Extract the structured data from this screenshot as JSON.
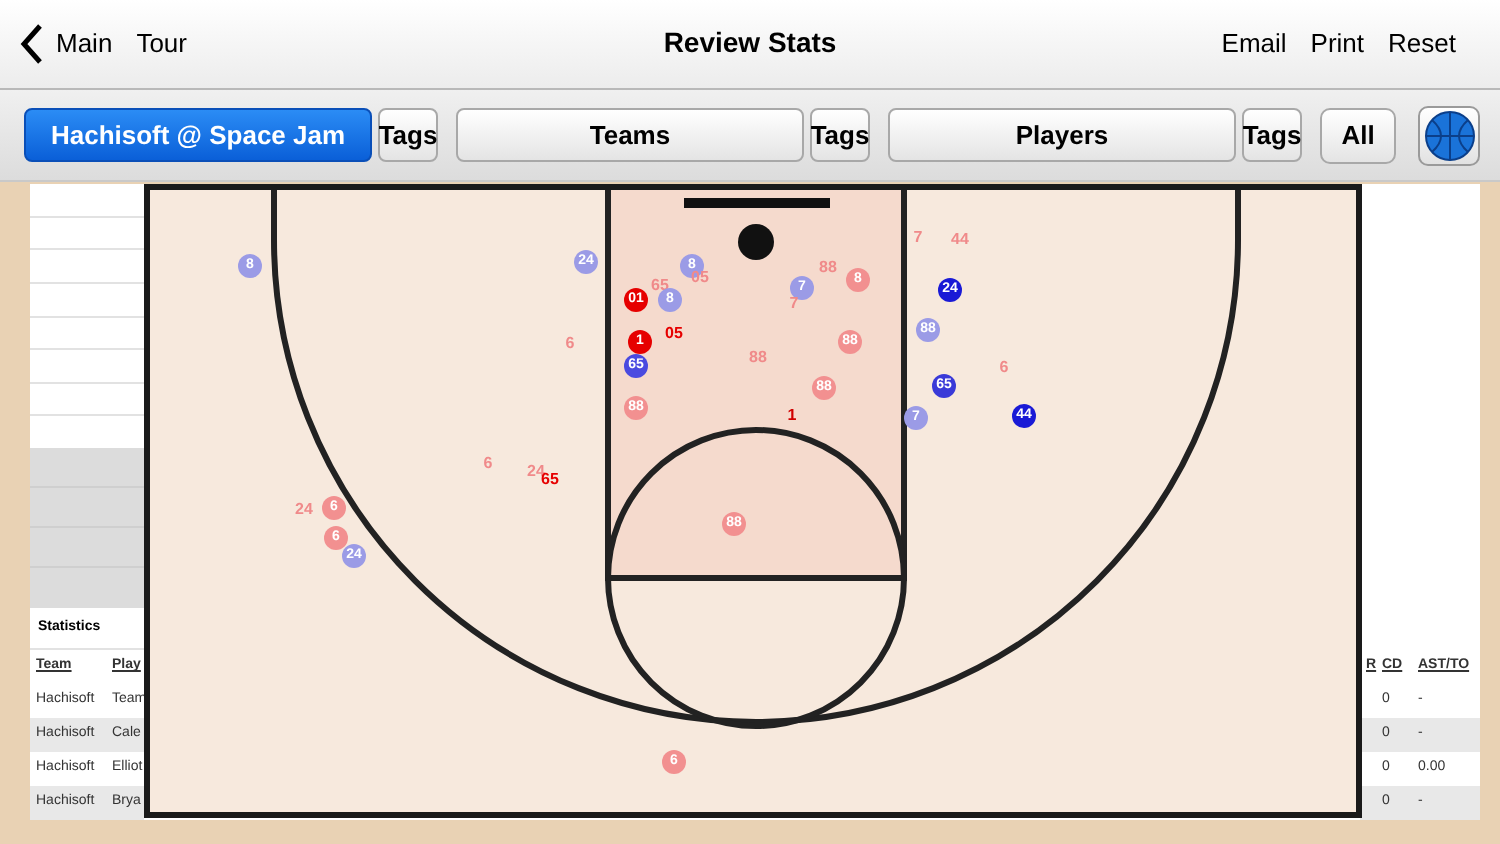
{
  "nav": {
    "back": "Main",
    "left_links": [
      "Tour"
    ],
    "title": "Review Stats",
    "right_links": [
      "Email",
      "Print",
      "Reset"
    ]
  },
  "filters": [
    {
      "label": "Hachisoft @ Space Jam",
      "kind": "selector",
      "selected": true
    },
    {
      "label": "Tags",
      "kind": "tags",
      "selected": false
    },
    {
      "label": "Teams",
      "kind": "selector",
      "selected": false
    },
    {
      "label": "Tags",
      "kind": "tags",
      "selected": false
    },
    {
      "label": "Players",
      "kind": "selector",
      "selected": false
    },
    {
      "label": "Tags",
      "kind": "tags",
      "selected": false
    },
    {
      "label": "All",
      "kind": "all",
      "selected": false
    }
  ],
  "statistics": {
    "title": "Statistics",
    "left_columns": [
      "Team",
      "Play"
    ],
    "left_rows": [
      [
        "Hachisoft",
        "Team"
      ],
      [
        "Hachisoft",
        "Cale"
      ],
      [
        "Hachisoft",
        "Elliot"
      ],
      [
        "Hachisoft",
        "Brya"
      ]
    ],
    "right_columns": [
      "R",
      "CD",
      "AST/TO"
    ],
    "right_rows": [
      [
        "",
        "0",
        "-"
      ],
      [
        "",
        "0",
        "-"
      ],
      [
        "",
        "0",
        "0.00"
      ],
      [
        "",
        "0",
        "-"
      ]
    ]
  },
  "shots": [
    {
      "label": "8",
      "kind": "dot",
      "color": "#9b9be6"
    },
    {
      "label": "24",
      "kind": "dot",
      "color": "#9b9be6"
    },
    {
      "label": "8",
      "kind": "dot",
      "color": "#9b9be6"
    },
    {
      "label": "65",
      "kind": "number",
      "color": "#f08a8a"
    },
    {
      "label": "05",
      "kind": "number",
      "color": "#f08a8a"
    },
    {
      "label": "01",
      "kind": "dot",
      "color": "#e60000"
    },
    {
      "label": "8",
      "kind": "dot",
      "color": "#9b9be6"
    },
    {
      "label": "1",
      "kind": "dot",
      "color": "#e60000"
    },
    {
      "label": "05",
      "kind": "number",
      "color": "#e60000"
    },
    {
      "label": "65",
      "kind": "dot",
      "color": "#4a4ae0"
    },
    {
      "label": "6",
      "kind": "number",
      "color": "#f08a8a"
    },
    {
      "label": "88",
      "kind": "dot",
      "color": "#f29090"
    },
    {
      "label": "7",
      "kind": "dot",
      "color": "#9b9be6"
    },
    {
      "label": "88",
      "kind": "number",
      "color": "#f08a8a"
    },
    {
      "label": "7",
      "kind": "number",
      "color": "#f08a8a"
    },
    {
      "label": "8",
      "kind": "dot",
      "color": "#f29090"
    },
    {
      "label": "88",
      "kind": "dot",
      "color": "#f29090"
    },
    {
      "label": "88",
      "kind": "number",
      "color": "#f08a8a"
    },
    {
      "label": "88",
      "kind": "dot",
      "color": "#f29090"
    },
    {
      "label": "1",
      "kind": "number",
      "color": "#d00000"
    },
    {
      "label": "7",
      "kind": "number",
      "color": "#f08a8a"
    },
    {
      "label": "44",
      "kind": "number",
      "color": "#f08a8a"
    },
    {
      "label": "24",
      "kind": "dot",
      "color": "#1a1ad6"
    },
    {
      "label": "88",
      "kind": "dot",
      "color": "#9b9be6"
    },
    {
      "label": "65",
      "kind": "dot",
      "color": "#3a3ad8"
    },
    {
      "label": "6",
      "kind": "number",
      "color": "#f08a8a"
    },
    {
      "label": "7",
      "kind": "dot",
      "color": "#9b9be6"
    },
    {
      "label": "44",
      "kind": "dot",
      "color": "#1a1ad6"
    },
    {
      "label": "6",
      "kind": "number",
      "color": "#f08a8a"
    },
    {
      "label": "24",
      "kind": "number",
      "color": "#f08a8a"
    },
    {
      "label": "65",
      "kind": "number",
      "color": "#e60000"
    },
    {
      "label": "24",
      "kind": "number",
      "color": "#f08a8a"
    },
    {
      "label": "6",
      "kind": "dot",
      "color": "#f29090"
    },
    {
      "label": "6",
      "kind": "dot",
      "color": "#f29090"
    },
    {
      "label": "24",
      "kind": "dot",
      "color": "#9b9be6"
    },
    {
      "label": "88",
      "kind": "dot",
      "color": "#f29090"
    },
    {
      "label": "6",
      "kind": "dot",
      "color": "#f29090"
    }
  ]
}
